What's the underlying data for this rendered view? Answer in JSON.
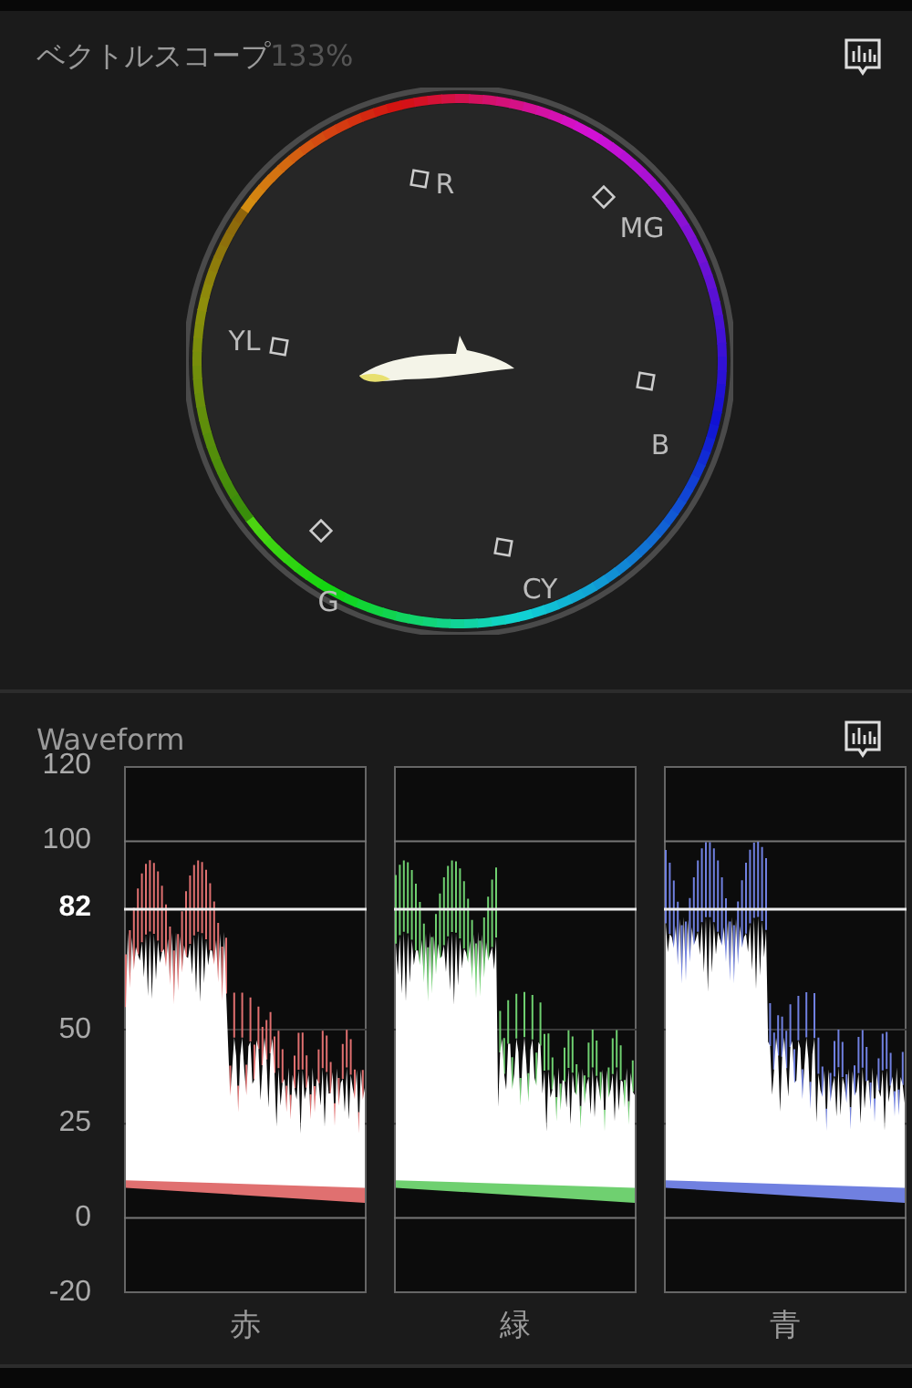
{
  "vectorscope": {
    "title": "ベクトルスコープ",
    "zoom": "133%",
    "targets": [
      {
        "label": "R"
      },
      {
        "label": "MG"
      },
      {
        "label": "B"
      },
      {
        "label": "CY"
      },
      {
        "label": "G"
      },
      {
        "label": "YL"
      }
    ]
  },
  "waveform": {
    "title": "Waveform",
    "scale": [
      {
        "label": "120",
        "highlighted": false
      },
      {
        "label": "100",
        "highlighted": false
      },
      {
        "label": "82",
        "highlighted": true
      },
      {
        "label": "50",
        "highlighted": false
      },
      {
        "label": "25",
        "highlighted": false
      },
      {
        "label": "0",
        "highlighted": false
      },
      {
        "label": "-20",
        "highlighted": false
      }
    ],
    "channels": [
      {
        "label": "赤",
        "color": "#e07070"
      },
      {
        "label": "緑",
        "color": "#6fd070"
      },
      {
        "label": "青",
        "color": "#7080e0"
      }
    ]
  }
}
